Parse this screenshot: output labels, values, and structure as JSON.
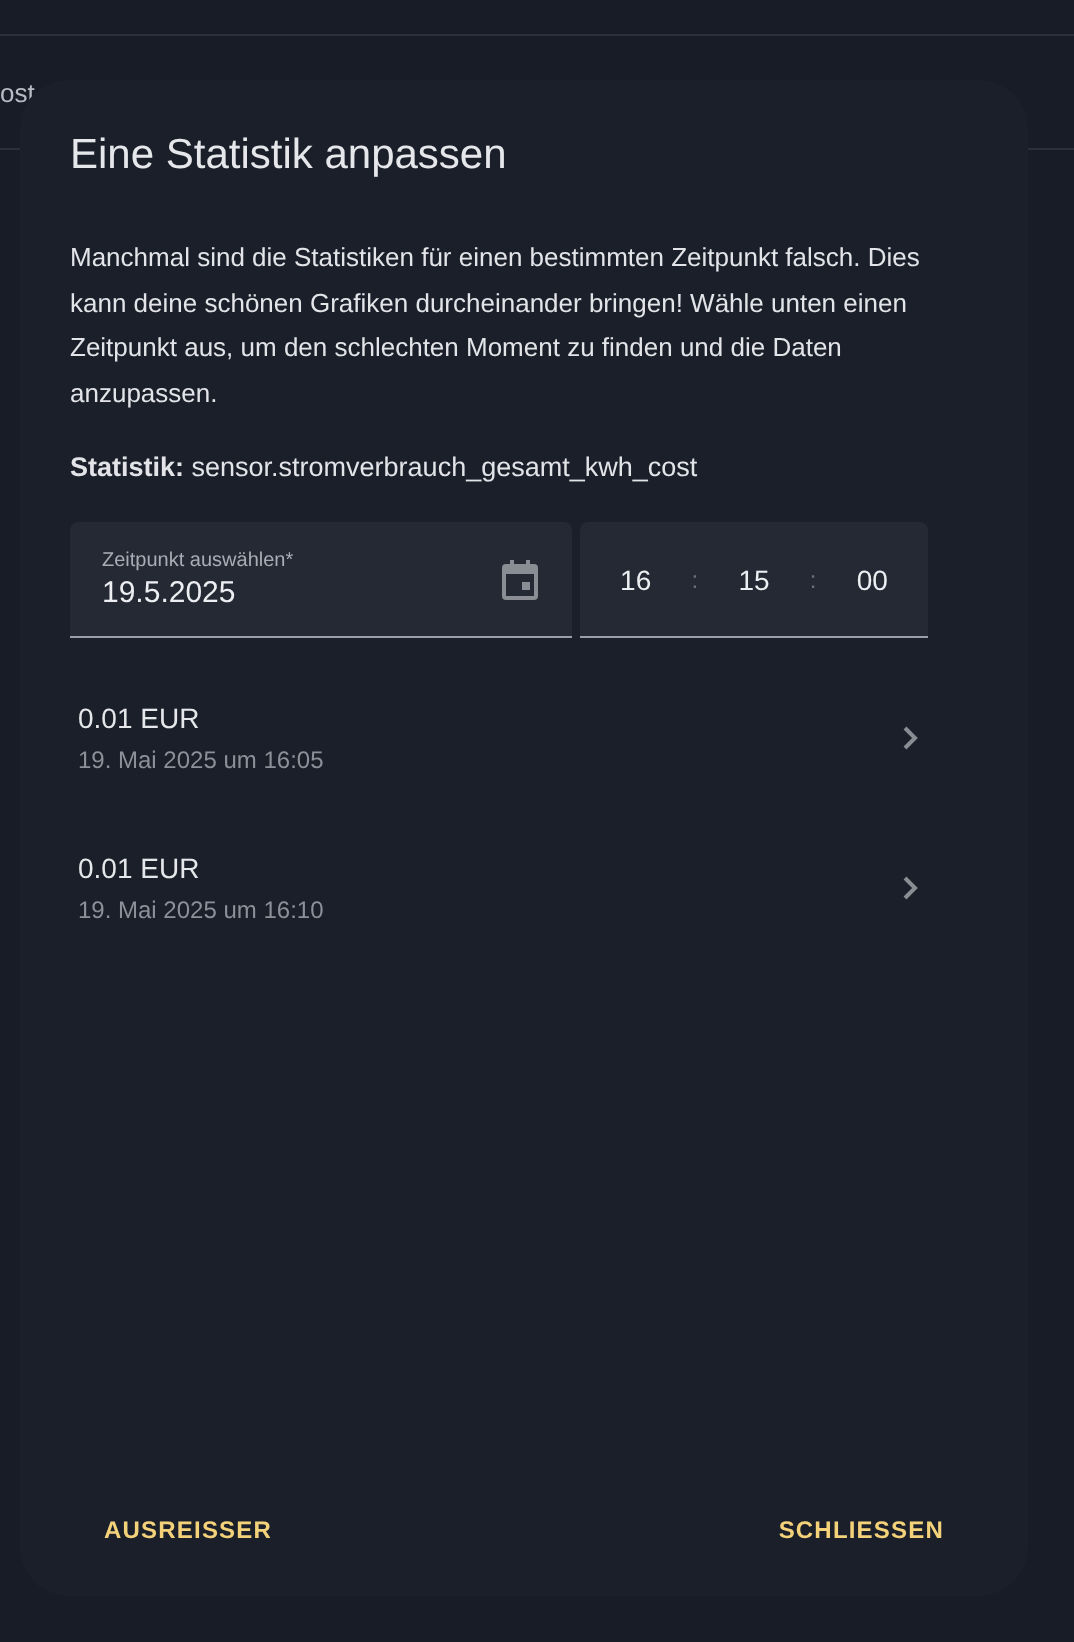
{
  "background": {
    "text": "ost"
  },
  "dialog": {
    "title": "Eine Statistik anpassen",
    "description": "Manchmal sind die Statistiken für einen bestimmten Zeitpunkt falsch. Dies kann deine schönen Grafiken durcheinander bringen! Wähle unten einen Zeitpunkt aus, um den schlechten Moment zu finden und die Daten anzupassen.",
    "statistic": "**Statistik:** sensor.stromverbrauch_gesamt_kwh_cost",
    "date_field": {
      "label": "Zeitpunkt auswählen*",
      "value": "19.5.2025"
    },
    "time_field": {
      "hours": "16",
      "minutes": "15",
      "seconds": "00",
      "separator": ":"
    },
    "entries": [
      {
        "value": "0.01 EUR",
        "time": "19. Mai 2025 um 16:05"
      },
      {
        "value": "0.01 EUR",
        "time": "19. Mai 2025 um 16:10"
      }
    ],
    "buttons": [
      "AUSREISSER",
      "SCHLIESSEN"
    ]
  }
}
